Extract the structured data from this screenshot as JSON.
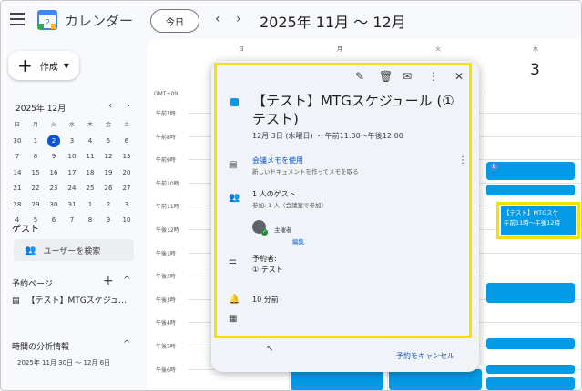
{
  "header": {
    "app_title": "カレンダー",
    "today_label": "今日",
    "prev": "‹",
    "next": "›",
    "range_title": "2025年 11月 ～ 12月",
    "logo_text": "2"
  },
  "sidebar": {
    "create_label": "作成",
    "mini_calendar": {
      "month_title": "2025年 12月",
      "weekdays": [
        "日",
        "月",
        "火",
        "水",
        "木",
        "金",
        "土"
      ],
      "weeks": [
        [
          "30",
          "1",
          "2",
          "3",
          "4",
          "5",
          "6"
        ],
        [
          "7",
          "8",
          "9",
          "10",
          "11",
          "12",
          "13"
        ],
        [
          "14",
          "15",
          "16",
          "17",
          "18",
          "19",
          "20"
        ],
        [
          "21",
          "22",
          "23",
          "24",
          "25",
          "26",
          "27"
        ],
        [
          "28",
          "29",
          "30",
          "31",
          "1",
          "2",
          "3"
        ],
        [
          "4",
          "5",
          "6",
          "7",
          "8",
          "9",
          "10"
        ]
      ],
      "today": "2"
    },
    "guest_title": "ゲスト",
    "guest_search_placeholder": "ユーザーを検索",
    "booking_title": "予約ページ",
    "booking_item": "【テスト】MTGスケジュ…",
    "analytics_title": "時間の分析情報",
    "analytics_range": "2025年 11月 30日 ～ 12月 6日"
  },
  "grid": {
    "days": [
      {
        "weekday": "日",
        "date": ""
      },
      {
        "weekday": "月",
        "date": ""
      },
      {
        "weekday": "火",
        "date": ""
      },
      {
        "weekday": "水",
        "date": "3"
      }
    ],
    "timezone": "GMT+09",
    "hours": [
      "午前7時",
      "午前8時",
      "午前9時",
      "午前10時",
      "午前11時",
      "午後12時",
      "午後1時",
      "午後2時",
      "午後3時",
      "午後4時",
      "午後5時",
      "午後6時"
    ],
    "event_badge": "B",
    "highlighted_event": {
      "title": "【テスト】MTGスケ",
      "time": "午前11時～午後12時"
    },
    "event_color": "#039be5"
  },
  "popup": {
    "title": "【テスト】MTGスケジュール (① テスト)",
    "time": "12月 3日 (水曜日) ・ 午前11:00～午後12:00",
    "notes_title": "会議メモを使用",
    "notes_sub": "新しいドキュメントを作ってメモを取る",
    "guests_title": "1 人のゲスト",
    "guests_sub": "参加: 1 人（会議室で参加）",
    "organizer": "主催者",
    "edit_label": "編集",
    "booker_title": "予約者:",
    "booker_name": "① テスト",
    "reminder": "10 分前",
    "cancel_label": "予約をキャンセル",
    "highlight_color": "#f5e100"
  }
}
